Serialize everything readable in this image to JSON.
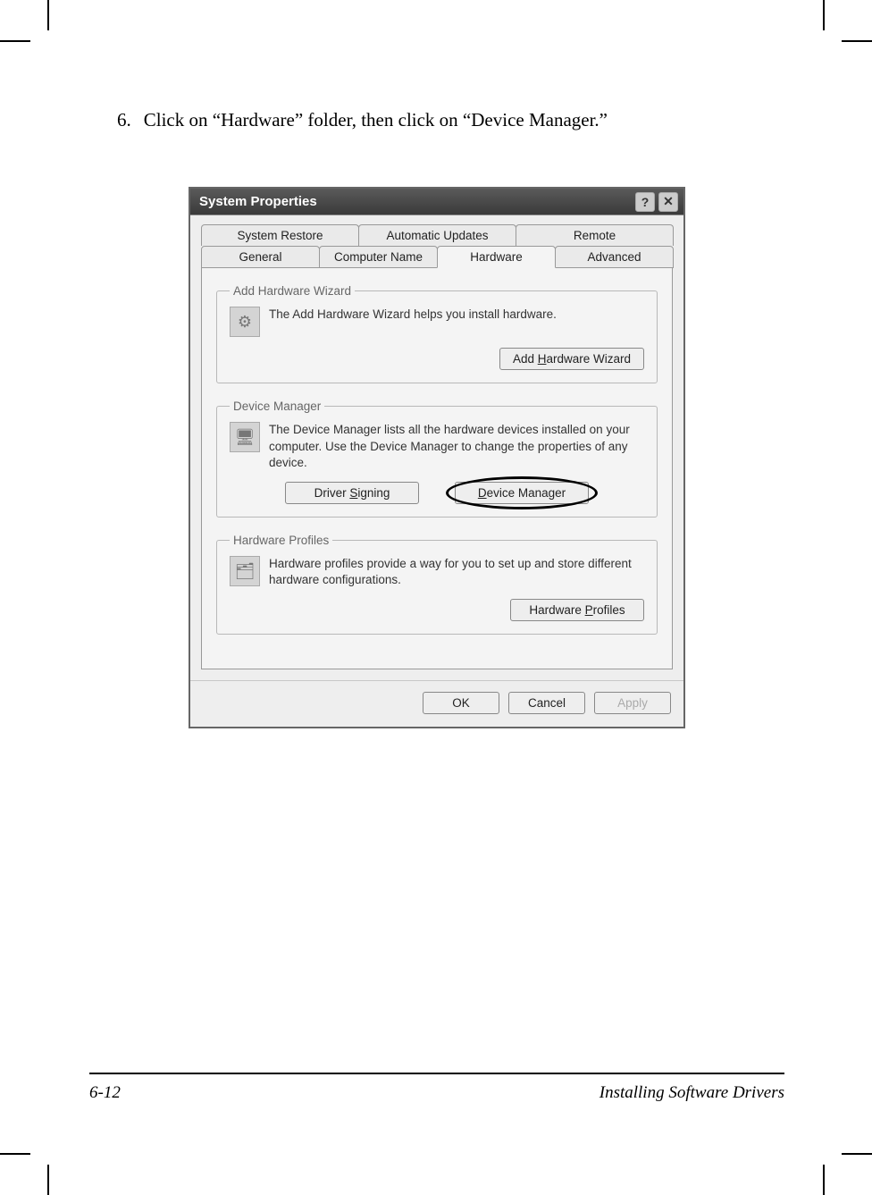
{
  "step": {
    "number": "6.",
    "text": "Click on “Hardware” folder, then click on “Device Manager.”"
  },
  "dialog": {
    "title": "System Properties",
    "help_glyph": "?",
    "close_glyph": "✕",
    "tabs_top": [
      "System Restore",
      "Automatic Updates",
      "Remote"
    ],
    "tabs_bottom": [
      "General",
      "Computer Name",
      "Hardware",
      "Advanced"
    ],
    "active_tab": "Hardware",
    "groups": {
      "add_hw": {
        "legend": "Add Hardware Wizard",
        "text": "The Add Hardware Wizard helps you install hardware.",
        "button": "Add Hardware Wizard"
      },
      "dev_mgr": {
        "legend": "Device Manager",
        "text": "The Device Manager lists all the hardware devices installed on your computer. Use the Device Manager to change the properties of any device.",
        "button_sign": "Driver Signing",
        "button_dm": "Device Manager"
      },
      "hw_prof": {
        "legend": "Hardware Profiles",
        "text": "Hardware profiles provide a way for you to set up and store different hardware configurations.",
        "button": "Hardware Profiles"
      }
    },
    "buttons": {
      "ok": "OK",
      "cancel": "Cancel",
      "apply": "Apply"
    }
  },
  "footer": {
    "page": "6-12",
    "section": "Installing Software Drivers"
  }
}
